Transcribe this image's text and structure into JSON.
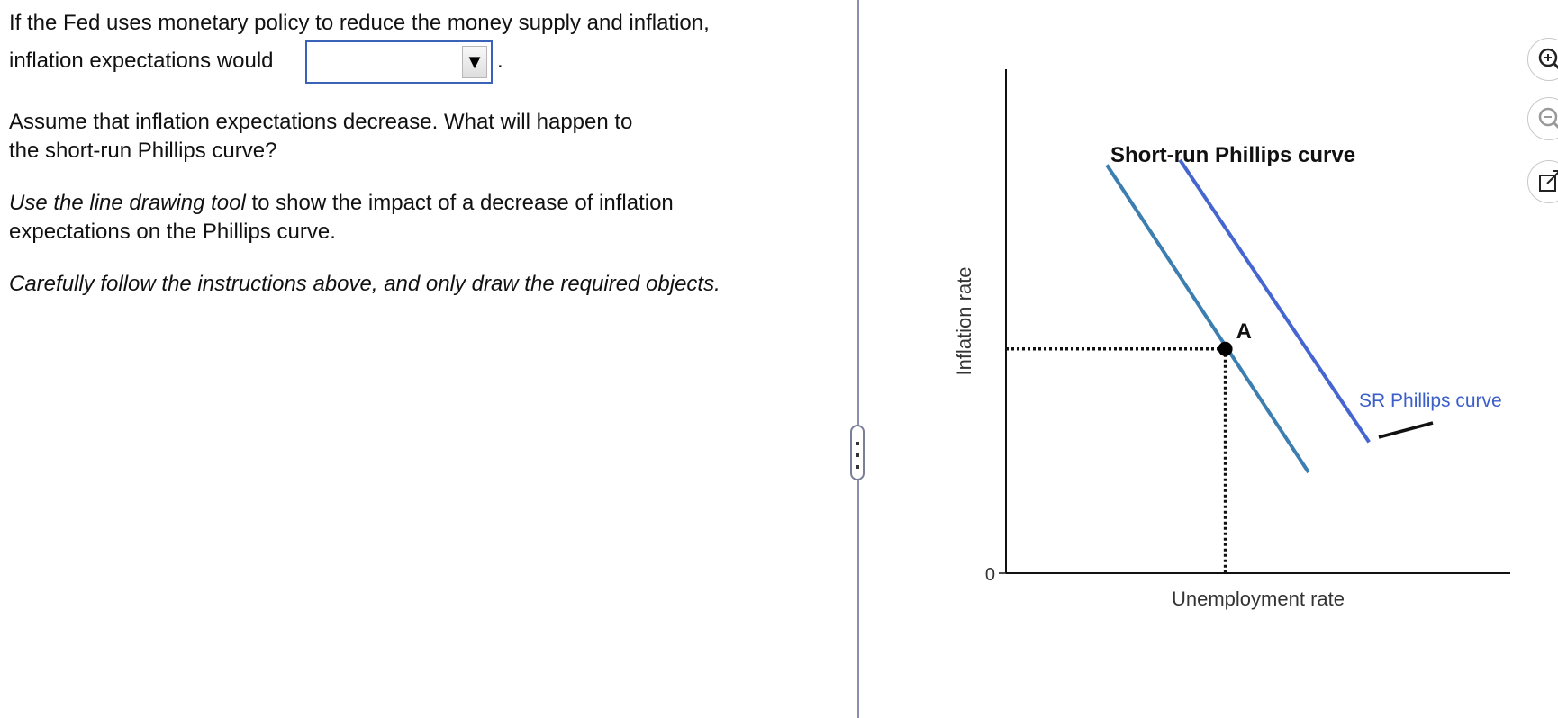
{
  "question": {
    "line1": "If the Fed uses monetary policy to reduce the money supply and inflation,",
    "line2_prefix": "inflation expectations would",
    "dropdown_value": "",
    "line2_suffix": ".",
    "para2_line1": "Assume that inflation expectations decrease. What will happen to",
    "para2_line2": "the short-run Phillips curve?",
    "para3_italic": "Use the line drawing tool",
    "para3_rest": " to show the impact of a decrease of inflation",
    "para3_line2": "expectations on the Phillips curve.",
    "para4": "Carefully follow the instructions above, and only draw the required objects."
  },
  "icons": {
    "dropdown_arrow": "triangle-down",
    "zoom_in": "zoom-in-icon",
    "zoom_out": "zoom-out-icon",
    "popout": "external-window-icon"
  },
  "chart_data": {
    "type": "line",
    "title": "Short-run Phillips curve",
    "xlabel": "Unemployment rate",
    "ylabel": "Inflation rate",
    "origin_label": "0",
    "xlim": [
      0,
      10
    ],
    "ylim": [
      0,
      10
    ],
    "point": {
      "label": "A",
      "x": 4.35,
      "y": 4.45
    },
    "series": [
      {
        "x": [
          2.0,
          6.0
        ],
        "y": [
          8.1,
          2.0
        ],
        "color": "#3c7eb0"
      },
      {
        "name": "SR Phillips curve",
        "x": [
          3.45,
          7.2
        ],
        "y": [
          8.2,
          2.6
        ],
        "color": "#4565d0"
      }
    ],
    "colors": {
      "axis": "#111111",
      "curve1": "#3c7eb0",
      "curve2": "#4565d0",
      "curve2_label": "#3b5fc9"
    }
  }
}
